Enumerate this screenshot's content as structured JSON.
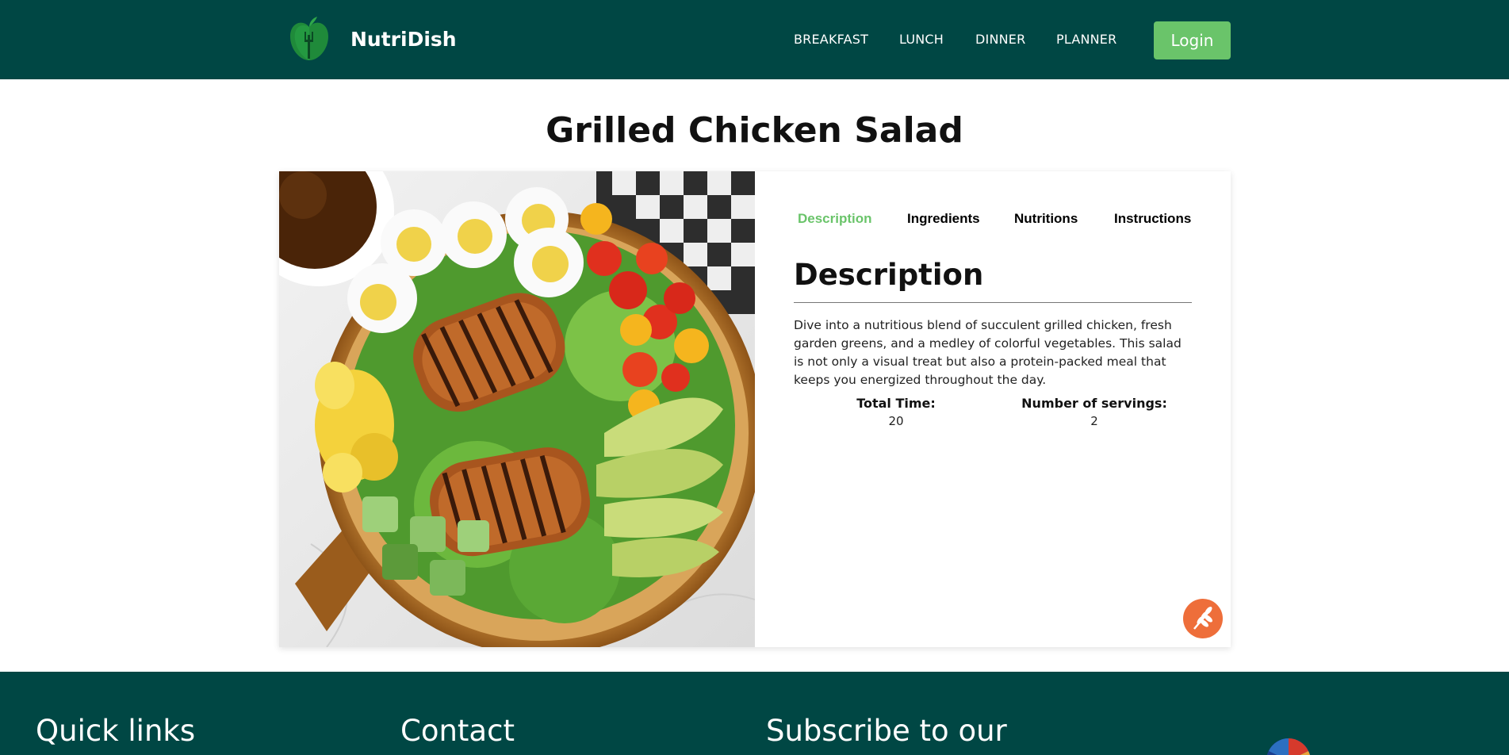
{
  "header": {
    "brand": "NutriDish",
    "logo_icon": "apple-fork-logo-icon",
    "nav": [
      "BREAKFAST",
      "LUNCH",
      "DINNER",
      "PLANNER"
    ],
    "login_label": "Login"
  },
  "recipe": {
    "title": "Grilled Chicken Salad",
    "image_alt": "Grilled chicken salad with eggs, tomatoes, avocado, corn and cucumber",
    "tabs": [
      "Description",
      "Ingredients",
      "Nutritions",
      "Instructions"
    ],
    "active_tab": "Description",
    "section_heading": "Description",
    "description": "Dive into a nutritious blend of succulent grilled chicken, fresh garden greens, and a medley of colorful vegetables. This salad is not only a visual treat but also a protein-packed meal that keeps you energized throughout the day.",
    "total_time_label": "Total Time:",
    "total_time_value": "20",
    "servings_label": "Number of servings:",
    "servings_value": "2",
    "badge_icon": "wheat-icon"
  },
  "footer": {
    "quick_links": "Quick links",
    "contact": "Contact",
    "subscribe": "Subscribe to our"
  },
  "colors": {
    "header_bg": "#004744",
    "accent": "#6ac46a",
    "badge": "#ee6e3a"
  }
}
